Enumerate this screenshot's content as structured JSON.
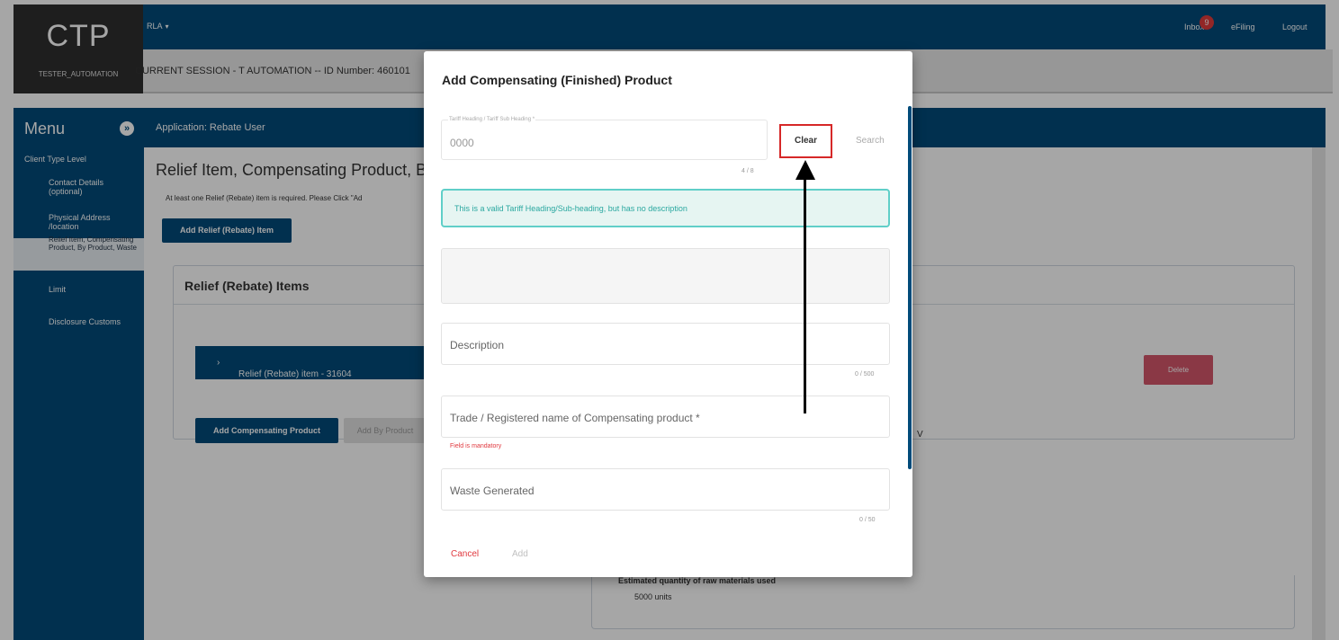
{
  "brand": {
    "title": "CTP",
    "user": "TESTER_AUTOMATION"
  },
  "topbar": {
    "role_menu": "RLA",
    "inbox": "Inbox",
    "inbox_count": "9",
    "efiling": "eFiling",
    "logout": "Logout"
  },
  "session": {
    "text": "CURRENT SESSION - T AUTOMATION -- ID Number: 460101"
  },
  "sidebar": {
    "menu_title": "Menu",
    "section": "Client Type Level",
    "items": [
      {
        "label": "Contact Details (optional)"
      },
      {
        "label": "Physical Address /location"
      },
      {
        "label": "Relief Item, Compensating Product, By Product, Waste"
      },
      {
        "label": "Limit"
      },
      {
        "label": "Disclosure Customs"
      }
    ]
  },
  "app": {
    "label": "Application: Rebate User"
  },
  "page": {
    "title": "Relief Item, Compensating Product, B",
    "info": "At least one Relief (Rebate) item is required. Please Click \"Ad",
    "add_relief_button": "Add Relief (Rebate) Item"
  },
  "relief_card": {
    "title": "Relief (Rebate) Items",
    "item_label": "Relief (Rebate) item - 31604",
    "delete_button": "Delete",
    "add_compensating_button": "Add Compensating Product",
    "add_by_product_button": "Add By Product",
    "trailing_letter": "V"
  },
  "estimated": {
    "label": "Estimated quantity of raw materials used",
    "value": "5000 units"
  },
  "modal": {
    "title": "Add Compensating (Finished) Product",
    "tariff": {
      "label": "Tariff Heading / Tariff Sub Heading *",
      "value": "0000",
      "counter": "4 / 8"
    },
    "clear_button": "Clear",
    "search_button": "Search",
    "valid_message": "This is a valid Tariff Heading/Sub-heading, but has no description",
    "description": {
      "placeholder": "Description",
      "counter": "0 / 500"
    },
    "trade_name": {
      "placeholder": "Trade / Registered name of Compensating product *",
      "error": "Field is mandatory"
    },
    "waste": {
      "placeholder": "Waste Generated",
      "counter": "0 / 50"
    },
    "cancel_button": "Cancel",
    "add_button": "Add"
  },
  "colors": {
    "primary": "#024b7a",
    "danger": "#e0383e",
    "highlight_box": "#d62828",
    "teal": "#60cfc8"
  }
}
